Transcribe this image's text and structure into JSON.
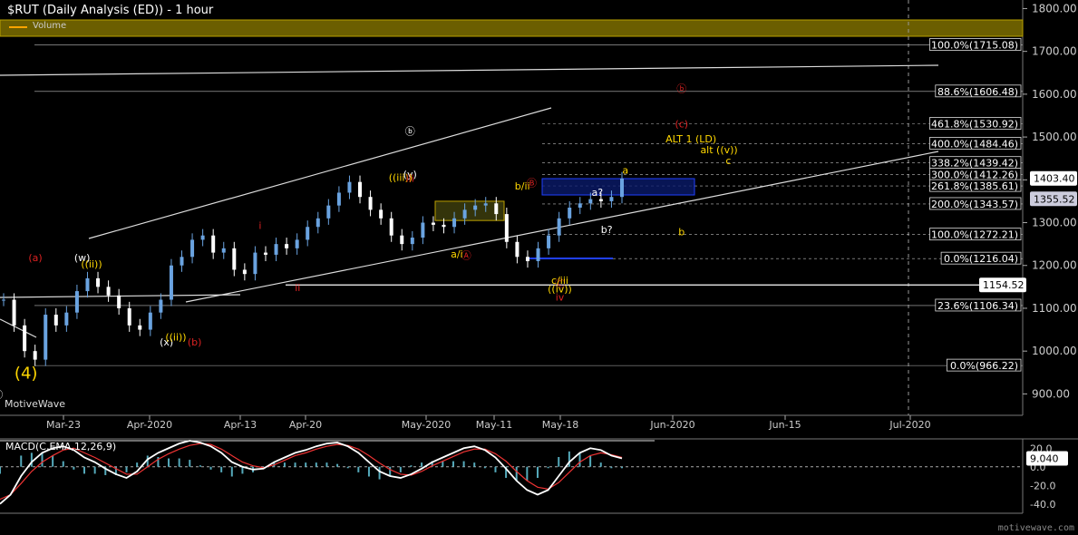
{
  "title": "$RUT (Daily Analysis (ED)) - 1 hour",
  "volume_label": "Volume",
  "brand": "MotiveWave",
  "watermark": "motivewave.com",
  "colors": {
    "up": "#6aa3e0",
    "down": "#ffffff",
    "fib": "#dddddd",
    "label": "#ffffff",
    "red": "#d22",
    "yellow": "#ffd700",
    "blue": "#2040ff",
    "olive": "#4a4a10",
    "macd": "#ffffff",
    "signal": "#e33",
    "hist": "#5ab"
  },
  "chart_data": [
    {
      "type": "line",
      "title": "$RUT (Daily Analysis (ED)) - 1 hour",
      "y_axis": {
        "ticks": [
          900,
          1000,
          1100,
          1200,
          1300,
          1400,
          1500,
          1600,
          1700,
          1800
        ],
        "ylim": [
          850,
          1820
        ],
        "side": "right"
      },
      "x_axis": {
        "ticks": [
          "Mar-23",
          "Apr-2020",
          "Apr-13",
          "Apr-20",
          "May-2020",
          "May-11",
          "May-18",
          "Jun-2020",
          "Jun-15",
          "Jul-2020"
        ]
      },
      "price_labels": [
        {
          "text": "1403.40",
          "value": 1403.4
        },
        {
          "text": "1355.52",
          "value": 1355.52
        },
        {
          "text": "1154.52",
          "value": 1154.52
        }
      ],
      "fib_levels": [
        {
          "label": "100.0%(1715.08)",
          "value": 1715.08
        },
        {
          "label": "88.6%(1606.48)",
          "value": 1606.48
        },
        {
          "label": "461.8%(1530.92)",
          "value": 1530.92
        },
        {
          "label": "400.0%(1484.46)",
          "value": 1484.46
        },
        {
          "label": "338.2%(1439.42)",
          "value": 1439.42
        },
        {
          "label": "300.0%(1412.26)",
          "value": 1412.26
        },
        {
          "label": "261.8%(1385.61)",
          "value": 1385.61
        },
        {
          "label": "200.0%(1343.57)",
          "value": 1343.57
        },
        {
          "label": "100.0%(1272.21)",
          "value": 1272.21
        },
        {
          "label": "0.0%(1216.04)",
          "value": 1216.04
        },
        {
          "label": "23.6%(1106.34)",
          "value": 1106.34
        },
        {
          "label": "0.0%(966.22)",
          "value": 966.22
        }
      ],
      "wave_labels": [
        {
          "text": "ⓑ",
          "color": "red",
          "x": "May-28",
          "value": 1605
        },
        {
          "text": "(c)",
          "color": "red",
          "x": "May-28",
          "value": 1522
        },
        {
          "text": "ALT 1 (LD)",
          "color": "yellow",
          "x": "May-29",
          "value": 1487
        },
        {
          "text": "alt ((v))",
          "color": "yellow",
          "x": "Jun-1",
          "value": 1462
        },
        {
          "text": "c",
          "color": "yellow",
          "x": "Jun-2",
          "value": 1437
        },
        {
          "text": "a",
          "color": "yellow",
          "x": "May-22",
          "value": 1414
        },
        {
          "text": "a?",
          "color": "white",
          "x": "May-19",
          "value": 1363
        },
        {
          "text": "b?",
          "color": "white",
          "x": "May-20",
          "value": 1276
        },
        {
          "text": "b",
          "color": "yellow",
          "x": "May-28",
          "value": 1270
        },
        {
          "text": "b/ii",
          "color": "yellow",
          "x": "May-11",
          "value": 1377
        },
        {
          "text": "Ⓑ",
          "color": "red",
          "x": "May-12",
          "value": 1385
        },
        {
          "text": "Ⓐ",
          "color": "red",
          "x": "May-5",
          "value": 1215
        },
        {
          "text": "a/i",
          "color": "yellow",
          "x": "May-4",
          "value": 1218
        },
        {
          "text": "ⓑ",
          "color": "white",
          "x": "Apr-29",
          "value": 1505
        },
        {
          "text": "(y)",
          "color": "white",
          "x": "Apr-29",
          "value": 1405
        },
        {
          "text": "((iii))",
          "color": "yellow",
          "x": "Apr-28",
          "value": 1397
        },
        {
          "text": "iii",
          "color": "red",
          "x": "Apr-29",
          "value": 1395
        },
        {
          "text": "i",
          "color": "red",
          "x": "Apr-13",
          "value": 1285
        },
        {
          "text": "ii",
          "color": "red",
          "x": "Apr-17",
          "value": 1140
        },
        {
          "text": "(a)",
          "color": "red",
          "x": "Mar-20",
          "value": 1210
        },
        {
          "text": "(w)",
          "color": "white",
          "x": "Mar-25",
          "value": 1210
        },
        {
          "text": "((ii))",
          "color": "yellow",
          "x": "Mar-26",
          "value": 1195
        },
        {
          "text": "(x)",
          "color": "white",
          "x": "Apr-3",
          "value": 1013
        },
        {
          "text": "((ii))",
          "color": "yellow",
          "x": "Apr-4",
          "value": 1025
        },
        {
          "text": "(b)",
          "color": "red",
          "x": "Apr-6",
          "value": 1013
        },
        {
          "text": "Ⓒ",
          "color": "red",
          "x": "May-15",
          "value": 1150
        },
        {
          "text": "c/iii",
          "color": "yellow",
          "x": "May-15",
          "value": 1157
        },
        {
          "text": "((iv))",
          "color": "yellow",
          "x": "May-15",
          "value": 1137
        },
        {
          "text": "iv",
          "color": "red",
          "x": "May-15",
          "value": 1118
        },
        {
          "text": "(4)",
          "color": "yellow",
          "x": "Mar-19",
          "value": 936
        },
        {
          "text": "ⓐ",
          "color": "white",
          "x": "Mar-16",
          "value": 890
        }
      ],
      "series": [
        {
          "name": "$RUT",
          "values": [
            1120,
            1060,
            1000,
            980,
            1085,
            1060,
            1090,
            1140,
            1170,
            1150,
            1130,
            1100,
            1060,
            1050,
            1090,
            1120,
            1200,
            1220,
            1260,
            1270,
            1230,
            1240,
            1190,
            1180,
            1230,
            1225,
            1250,
            1240,
            1260,
            1290,
            1310,
            1340,
            1370,
            1395,
            1360,
            1330,
            1310,
            1270,
            1250,
            1265,
            1300,
            1295,
            1290,
            1310,
            1330,
            1340,
            1345,
            1320,
            1255,
            1220,
            1210,
            1240,
            1270,
            1310,
            1335,
            1345,
            1355,
            1350,
            1360,
            1403
          ]
        }
      ]
    },
    {
      "type": "line",
      "title": "MACD(C,EMA,12,26,9)",
      "y_axis": {
        "ticks": [
          20,
          0,
          -20,
          -40
        ],
        "ylim": [
          -50,
          30
        ]
      },
      "price_labels": [
        {
          "text": "9.040",
          "value": 9.04
        }
      ],
      "series": [
        {
          "name": "MACD",
          "values": [
            -40,
            -30,
            -10,
            5,
            15,
            20,
            22,
            18,
            10,
            5,
            -2,
            -8,
            -12,
            -5,
            8,
            15,
            20,
            25,
            28,
            26,
            22,
            15,
            5,
            0,
            -3,
            -2,
            5,
            10,
            15,
            18,
            22,
            25,
            26,
            22,
            15,
            5,
            -5,
            -10,
            -12,
            -8,
            -2,
            5,
            10,
            15,
            20,
            22,
            18,
            10,
            -2,
            -15,
            -25,
            -30,
            -25,
            -10,
            5,
            15,
            20,
            18,
            12,
            9
          ]
        },
        {
          "name": "Signal",
          "values": [
            -35,
            -30,
            -18,
            -5,
            5,
            12,
            18,
            20,
            15,
            10,
            4,
            -2,
            -8,
            -8,
            0,
            8,
            14,
            19,
            23,
            25,
            24,
            19,
            12,
            5,
            1,
            -1,
            2,
            7,
            12,
            15,
            19,
            22,
            24,
            23,
            19,
            12,
            4,
            -3,
            -8,
            -9,
            -5,
            1,
            6,
            11,
            16,
            19,
            19,
            14,
            6,
            -5,
            -15,
            -22,
            -24,
            -17,
            -6,
            5,
            12,
            15,
            13,
            10
          ]
        }
      ]
    }
  ],
  "olive_box": {
    "x1": "May-7",
    "x2": "May-14",
    "y1": 1305,
    "y2": 1350
  },
  "blue_box": {
    "x1": "May-18",
    "x2": "Jun-5",
    "y1": 1265,
    "y2": 1305
  }
}
